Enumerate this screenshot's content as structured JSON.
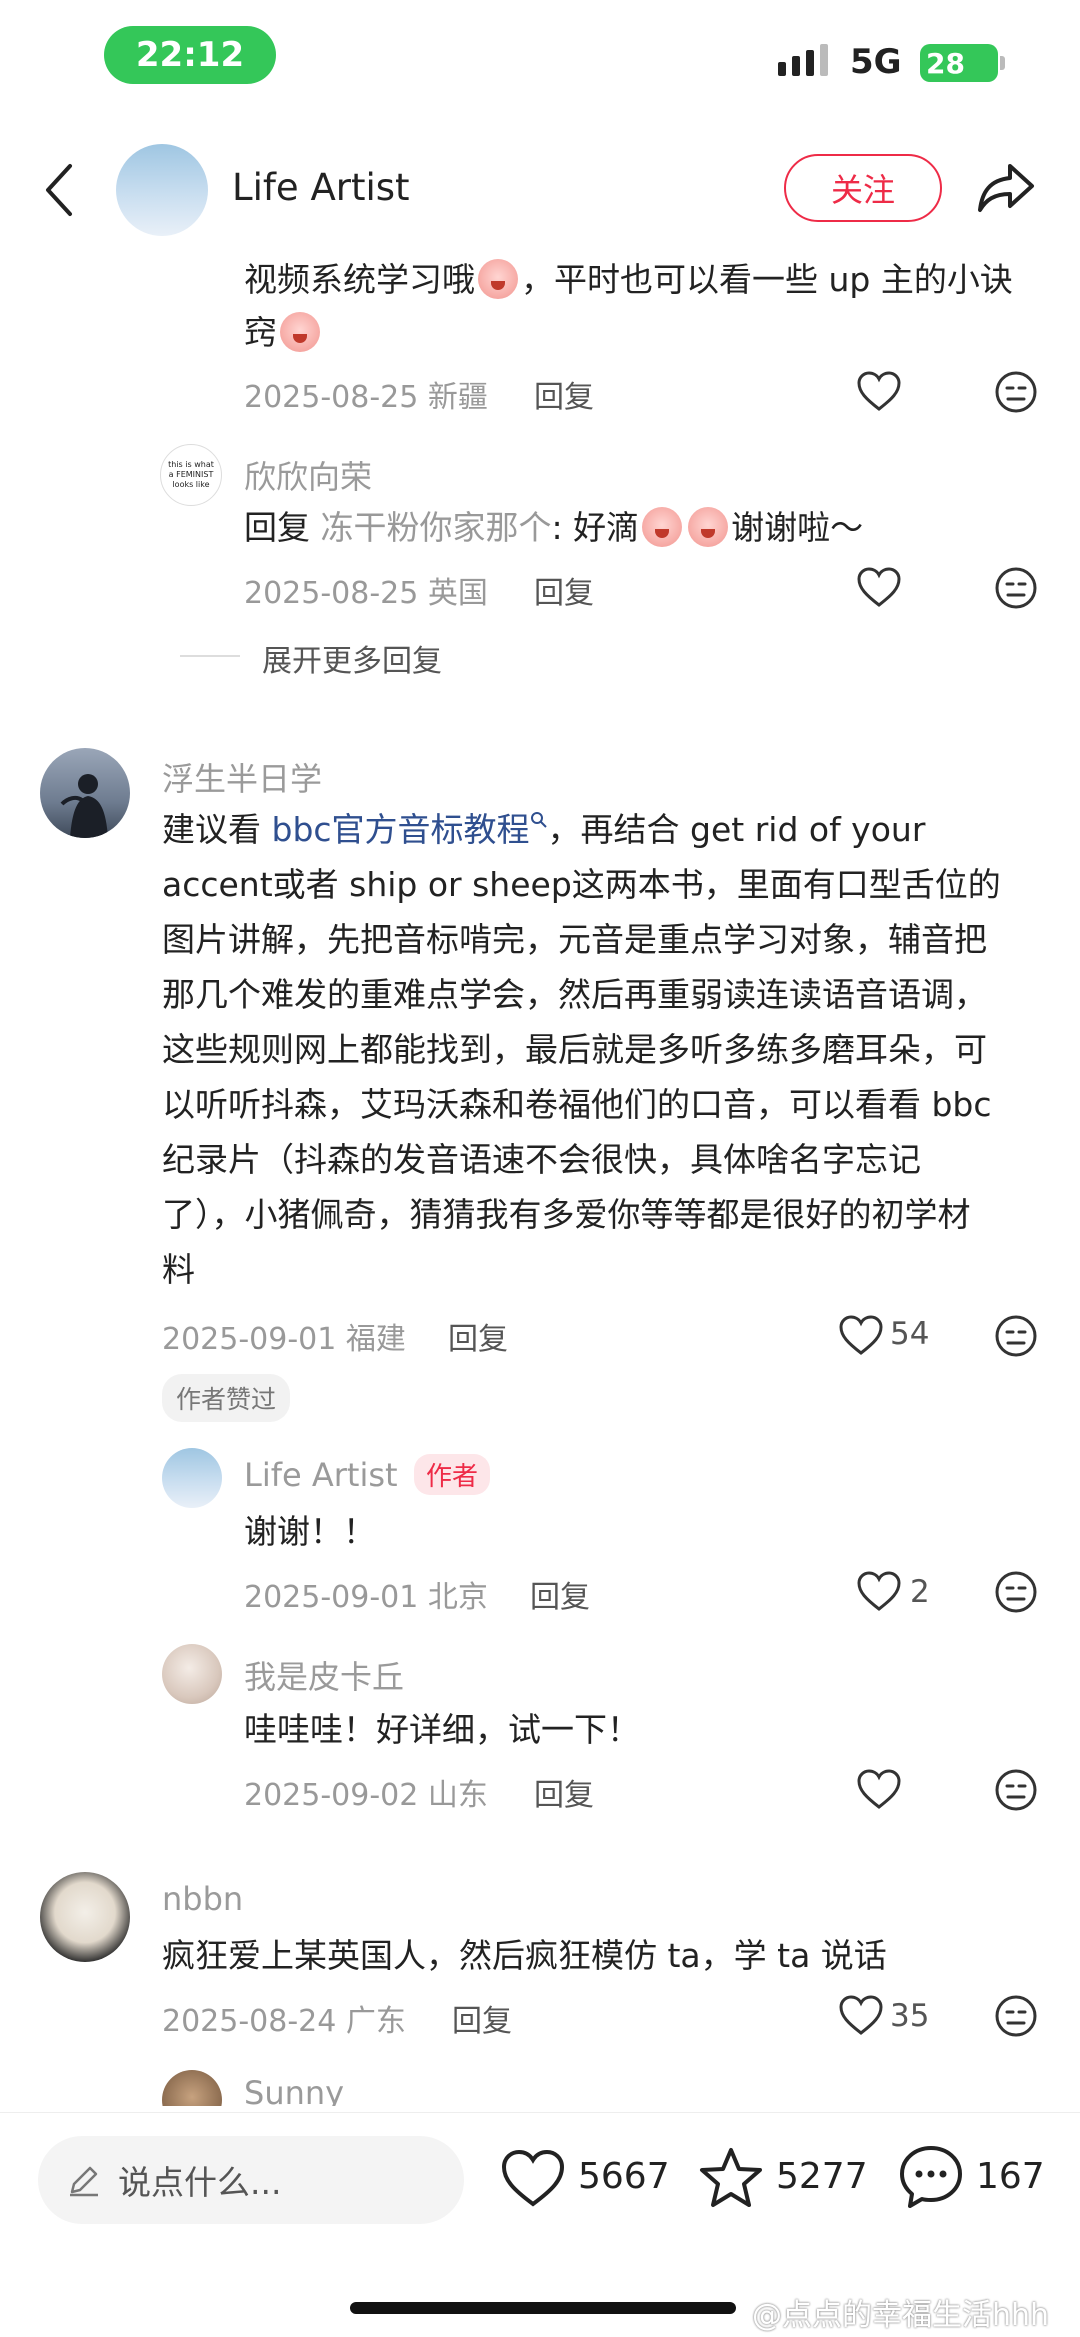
{
  "status_bar": {
    "time": "22:12",
    "network": "5G",
    "battery": "28"
  },
  "header": {
    "name": "Life Artist",
    "follow_label": "关注"
  },
  "thread0": {
    "tail_line1": "视频系统学习哦",
    "tail_line1b": "，平时也可以看一些 up 主的小诀",
    "tail_line2": "窍",
    "date": "2025-08-25 新疆",
    "reply": "回复"
  },
  "sub1": {
    "name": "欣欣向荣",
    "reply_prefix": "回复",
    "reply_to": "冻干粉你家那个",
    "text_a": ": 好滴",
    "text_b": "谢谢啦～",
    "date": "2025-08-25 英国",
    "reply": "回复",
    "avatar_text": "this is what a FEMINIST looks like"
  },
  "expand_label": "展开更多回复",
  "c2": {
    "name": "浮生半日学",
    "line1_pre": "建议看 ",
    "line1_link": "bbc官方音标教程",
    "line1_post": "，再结合 get rid of your",
    "line2": "accent或者 ship or sheep这两本书，里面有口型舌位的",
    "line3": "图片讲解，先把音标啃完，元音是重点学习对象，辅音把",
    "line4": "那几个难发的重难点学会，然后再重弱读连读语音语调，",
    "line5": "这些规则网上都能找到，最后就是多听多练多磨耳朵，可",
    "line6": "以听听抖森，艾玛沃森和卷福他们的口音，可以看看 bbc",
    "line7": "纪录片（抖森的发音语速不会很快，具体啥名字忘记",
    "line8": "了），小猪佩奇，猜猜我有多爱你等等都是很好的初学材",
    "line9": "料",
    "date": "2025-09-01 福建",
    "reply": "回复",
    "likes": "54",
    "author_liked": "作者赞过"
  },
  "sub2": {
    "name": "Life Artist",
    "author_badge": "作者",
    "text": "谢谢！！",
    "date": "2025-09-01 北京",
    "reply": "回复",
    "likes": "2"
  },
  "sub3": {
    "name": "我是皮卡丘",
    "text": "哇哇哇！好详细，试一下！",
    "date": "2025-09-02 山东",
    "reply": "回复"
  },
  "c3": {
    "name": "nbbn",
    "text": "疯狂爱上某英国人，然后疯狂模仿 ta，学 ta 说话",
    "date": "2025-08-24 广东",
    "reply": "回复",
    "likes": "35"
  },
  "c4": {
    "name": "Sunny"
  },
  "bottom_bar": {
    "input_placeholder": "说点什么...",
    "likes": "5667",
    "favorites": "5277",
    "comments": "167"
  },
  "watermark": "@点点的幸福生活hhh",
  "colors": {
    "accent": "#ee2b47",
    "status_green": "#34c759",
    "link": "#2f4f8f"
  }
}
